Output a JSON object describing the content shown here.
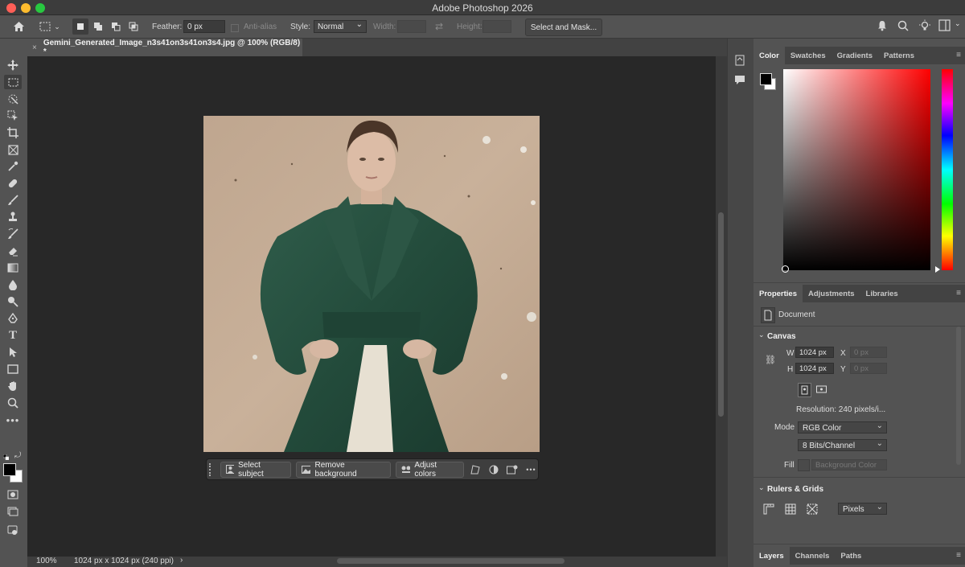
{
  "app": {
    "title": "Adobe Photoshop 2026"
  },
  "options": {
    "feather_label": "Feather:",
    "feather_value": "0 px",
    "antialias_label": "Anti-alias",
    "style_label": "Style:",
    "style_value": "Normal",
    "width_label": "Width:",
    "height_label": "Height:",
    "select_mask_label": "Select and Mask..."
  },
  "document": {
    "tab_name": "Gemini_Generated_Image_n3s41on3s41on3s4.jpg @ 100% (RGB/8) *",
    "zoom": "100%",
    "info": "1024 px x 1024 px (240 ppi)"
  },
  "context_bar": {
    "select_subject": "Select subject",
    "remove_background": "Remove background",
    "adjust_colors": "Adjust colors",
    "more": "•••"
  },
  "color_panel": {
    "tabs": [
      "Color",
      "Swatches",
      "Gradients",
      "Patterns"
    ],
    "active": "Color",
    "hue_color": "#ff0000",
    "foreground": "#000000",
    "background": "#ffffff"
  },
  "properties_panel": {
    "tabs": [
      "Properties",
      "Adjustments",
      "Libraries"
    ],
    "active": "Properties",
    "document_label": "Document",
    "canvas_title": "Canvas",
    "w_label": "W",
    "w_value": "1024 px",
    "h_label": "H",
    "h_value": "1024 px",
    "x_label": "X",
    "x_value": "0 px",
    "y_label": "Y",
    "y_value": "0 px",
    "resolution": "Resolution: 240 pixels/i...",
    "mode_label": "Mode",
    "mode_value": "RGB Color",
    "bits_value": "8 Bits/Channel",
    "fill_label": "Fill",
    "fill_value": "Background Color",
    "rulers_title": "Rulers & Grids",
    "units_value": "Pixels"
  },
  "layers_panel": {
    "tabs": [
      "Layers",
      "Channels",
      "Paths"
    ],
    "active": "Layers"
  },
  "toolbar": {
    "colors": {
      "foreground": "#000000",
      "background": "#ffffff"
    }
  }
}
